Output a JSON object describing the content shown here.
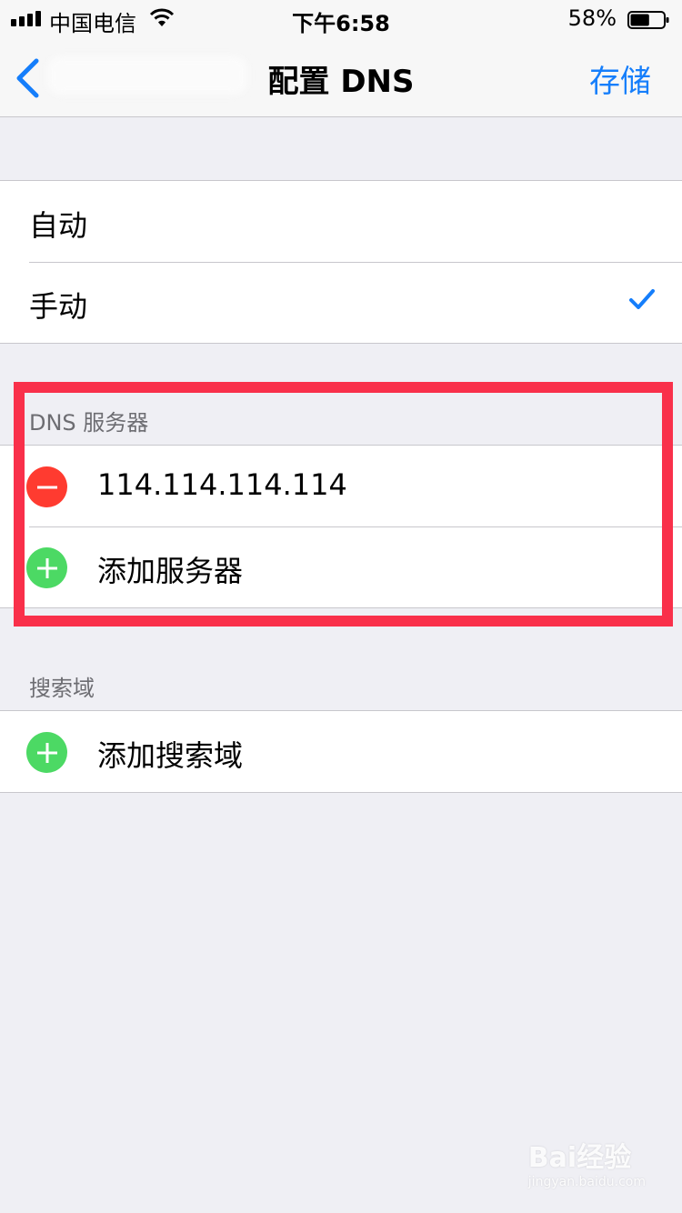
{
  "status_bar": {
    "carrier": "中国电信",
    "time": "下午6:58",
    "battery": "58%",
    "battery_level": 0.58
  },
  "nav": {
    "title": "配置 DNS",
    "save_label": "存储",
    "back_icon": "chevron-left-icon"
  },
  "mode": {
    "options": [
      {
        "label": "自动",
        "selected": false
      },
      {
        "label": "手动",
        "selected": true
      }
    ]
  },
  "dns": {
    "header": "DNS 服务器",
    "servers": [
      "114.114.114.114"
    ],
    "add_label": "添加服务器"
  },
  "search_domains": {
    "header": "搜索域",
    "add_label": "添加搜索域"
  },
  "colors": {
    "accent": "#157efb",
    "delete": "#ff3b30",
    "add": "#4cd964",
    "highlight": "#f9304a"
  },
  "watermark": {
    "logo": "Bai经验",
    "url": "jingyan.baidu.com"
  }
}
